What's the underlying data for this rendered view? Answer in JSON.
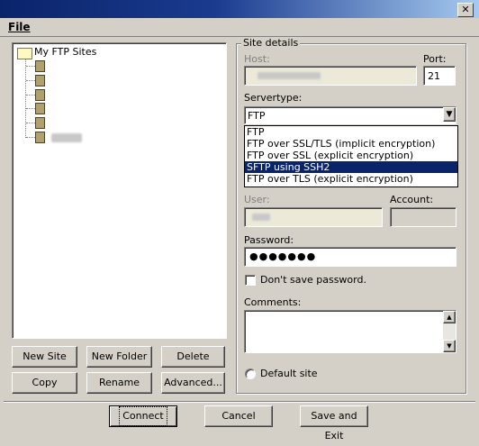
{
  "menu": {
    "file": "File"
  },
  "tree": {
    "root_label": "My FTP Sites"
  },
  "site_details": {
    "legend": "Site details",
    "host_label": "Host:",
    "port_label": "Port:",
    "port_value": "21",
    "servertype_label": "Servertype:",
    "servertype_value": "FTP",
    "servertype_options": [
      "FTP",
      "FTP over SSL/TLS (implicit encryption)",
      "FTP over SSL (explicit encryption)",
      "SFTP using SSH2",
      "FTP over TLS (explicit encryption)"
    ],
    "highlighted_option_index": 3,
    "user_label": "User:",
    "account_label": "Account:",
    "password_label": "Password:",
    "password_value": "●●●●●●●",
    "dont_save_label": "Don't save password.",
    "comments_label": "Comments:",
    "default_site_label": "Default site"
  },
  "buttons": {
    "new_site": "New Site",
    "new_folder": "New Folder",
    "delete": "Delete",
    "copy": "Copy",
    "rename": "Rename",
    "advanced": "Advanced...",
    "connect": "Connect",
    "cancel": "Cancel",
    "save_exit": "Save and Exit"
  },
  "colors": {
    "selection": "#0a246a",
    "face": "#d4d0c8"
  }
}
